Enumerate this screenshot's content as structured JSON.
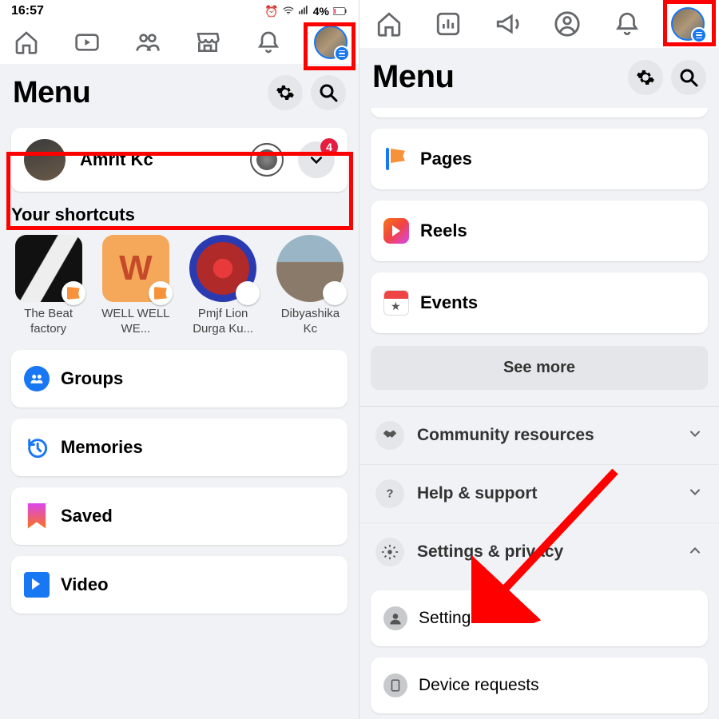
{
  "status": {
    "time": "16:57",
    "battery": "4%"
  },
  "left": {
    "menu_title": "Menu",
    "profile": {
      "name": "Amrit Kc",
      "notif_count": "4"
    },
    "shortcuts_heading": "Your shortcuts",
    "shortcuts": [
      {
        "label": "The Beat factory"
      },
      {
        "label": "WELL WELL WE..."
      },
      {
        "label": "Pmjf Lion Durga Ku..."
      },
      {
        "label": "Dibyashika Kc"
      }
    ],
    "items": [
      {
        "label": "Groups"
      },
      {
        "label": "Memories"
      },
      {
        "label": "Saved"
      },
      {
        "label": "Video"
      }
    ]
  },
  "right": {
    "menu_title": "Menu",
    "items": [
      {
        "label": "Pages"
      },
      {
        "label": "Reels"
      },
      {
        "label": "Events"
      }
    ],
    "see_more": "See more",
    "expand": [
      {
        "label": "Community resources"
      },
      {
        "label": "Help & support"
      },
      {
        "label": "Settings & privacy"
      }
    ],
    "sub": [
      {
        "label": "Settings"
      },
      {
        "label": "Device requests"
      }
    ]
  }
}
